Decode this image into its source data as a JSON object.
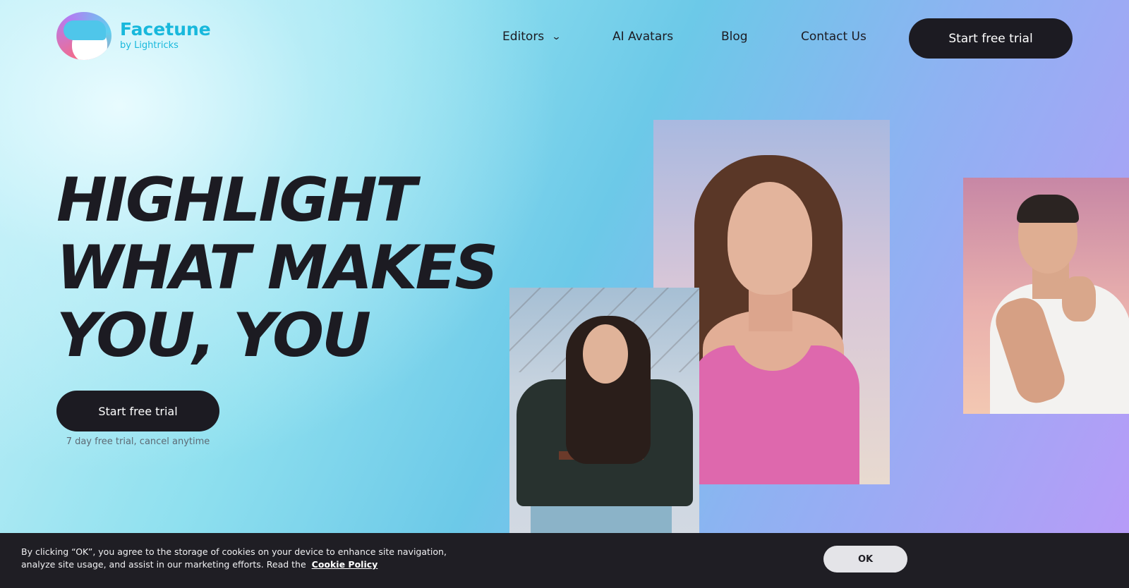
{
  "brand": {
    "name": "Facetune",
    "subtitle": "by Lightricks",
    "accent_color": "#18b8dc"
  },
  "nav": {
    "items": [
      {
        "label": "Editors",
        "has_dropdown": true,
        "icon": "chevron-down-icon"
      },
      {
        "label": "AI Avatars"
      },
      {
        "label": "Blog"
      },
      {
        "label": "Contact Us"
      }
    ],
    "cta_label": "Start free trial"
  },
  "hero": {
    "title_lines": [
      "HIGHLIGHT",
      "WHAT MAKES",
      "YOU, YOU"
    ],
    "cta_label": "Start free trial",
    "note": "7 day free trial, cancel anytime"
  },
  "cookie_banner": {
    "text": "By clicking “OK”, you agree to the storage of cookies on your device to enhance site navigation, analyze site usage, and assist in our marketing efforts. Read the",
    "link_label": "Cookie Policy",
    "ok_label": "OK",
    "background_color": "#1f1e24"
  },
  "colors": {
    "dark": "#1c1b22",
    "gradient_start": "#c9f2f8",
    "gradient_end": "#b99af8"
  }
}
